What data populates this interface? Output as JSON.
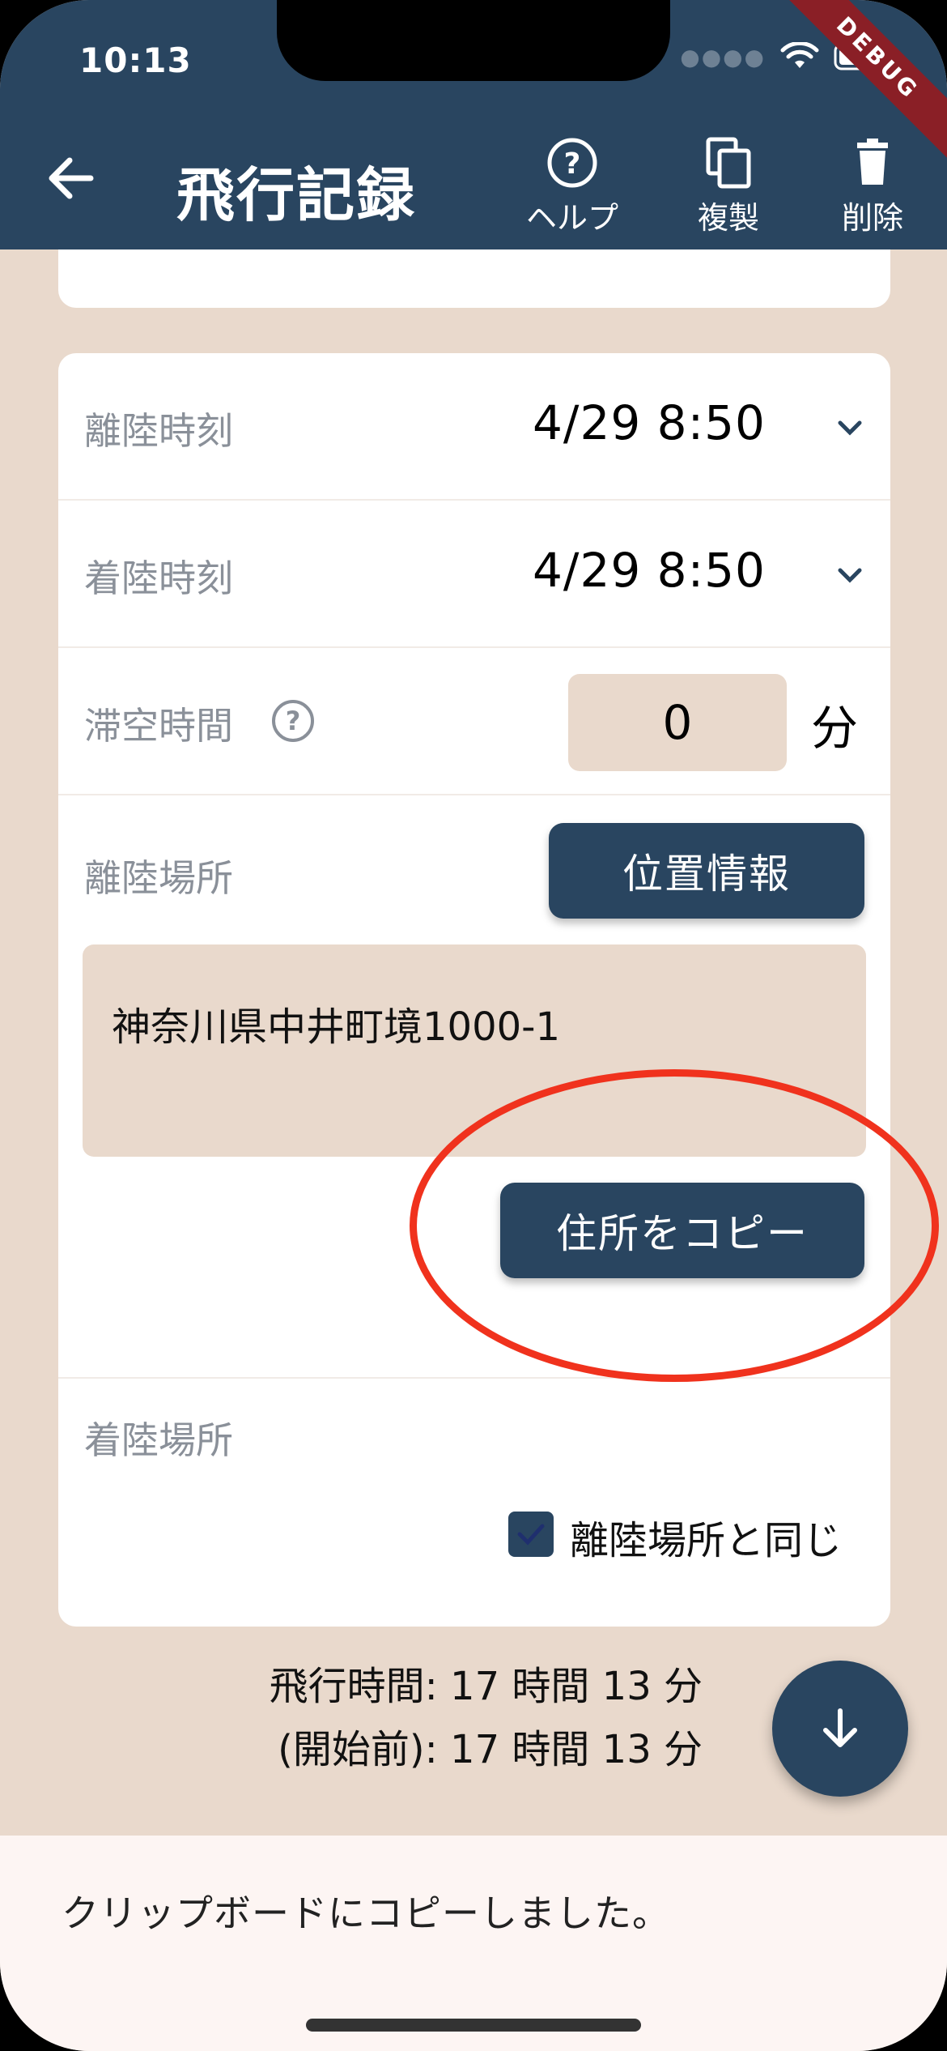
{
  "status_bar": {
    "time": "10:13",
    "debug_label": "DEBUG"
  },
  "app_bar": {
    "title": "飛行記録",
    "actions": [
      {
        "label": "ヘルプ",
        "icon": "help-circle-icon"
      },
      {
        "label": "複製",
        "icon": "copy-icon"
      },
      {
        "label": "削除",
        "icon": "trash-icon"
      }
    ]
  },
  "form": {
    "takeoff_time": {
      "label": "離陸時刻",
      "value": "4/29 8:50"
    },
    "landing_time": {
      "label": "着陸時刻",
      "value": "4/29 8:50"
    },
    "airtime": {
      "label": "滞空時間",
      "value": "0",
      "unit": "分"
    },
    "takeoff_place": {
      "label": "離陸場所",
      "location_button": "位置情報",
      "address": "神奈川県中井町境1000-1",
      "copy_button": "住所をコピー"
    },
    "landing_place": {
      "label": "着陸場所",
      "same_as_takeoff_label": "離陸場所と同じ",
      "same_as_takeoff_checked": true
    }
  },
  "summary": {
    "flight_time": "飛行時間: 17 時間 13 分",
    "before_start": "(開始前): 17 時間 13 分"
  },
  "snackbar": {
    "message": "クリップボードにコピーしました。"
  },
  "colors": {
    "primary": "#294560",
    "background": "#e9d9cc",
    "highlight": "#f0321d"
  }
}
